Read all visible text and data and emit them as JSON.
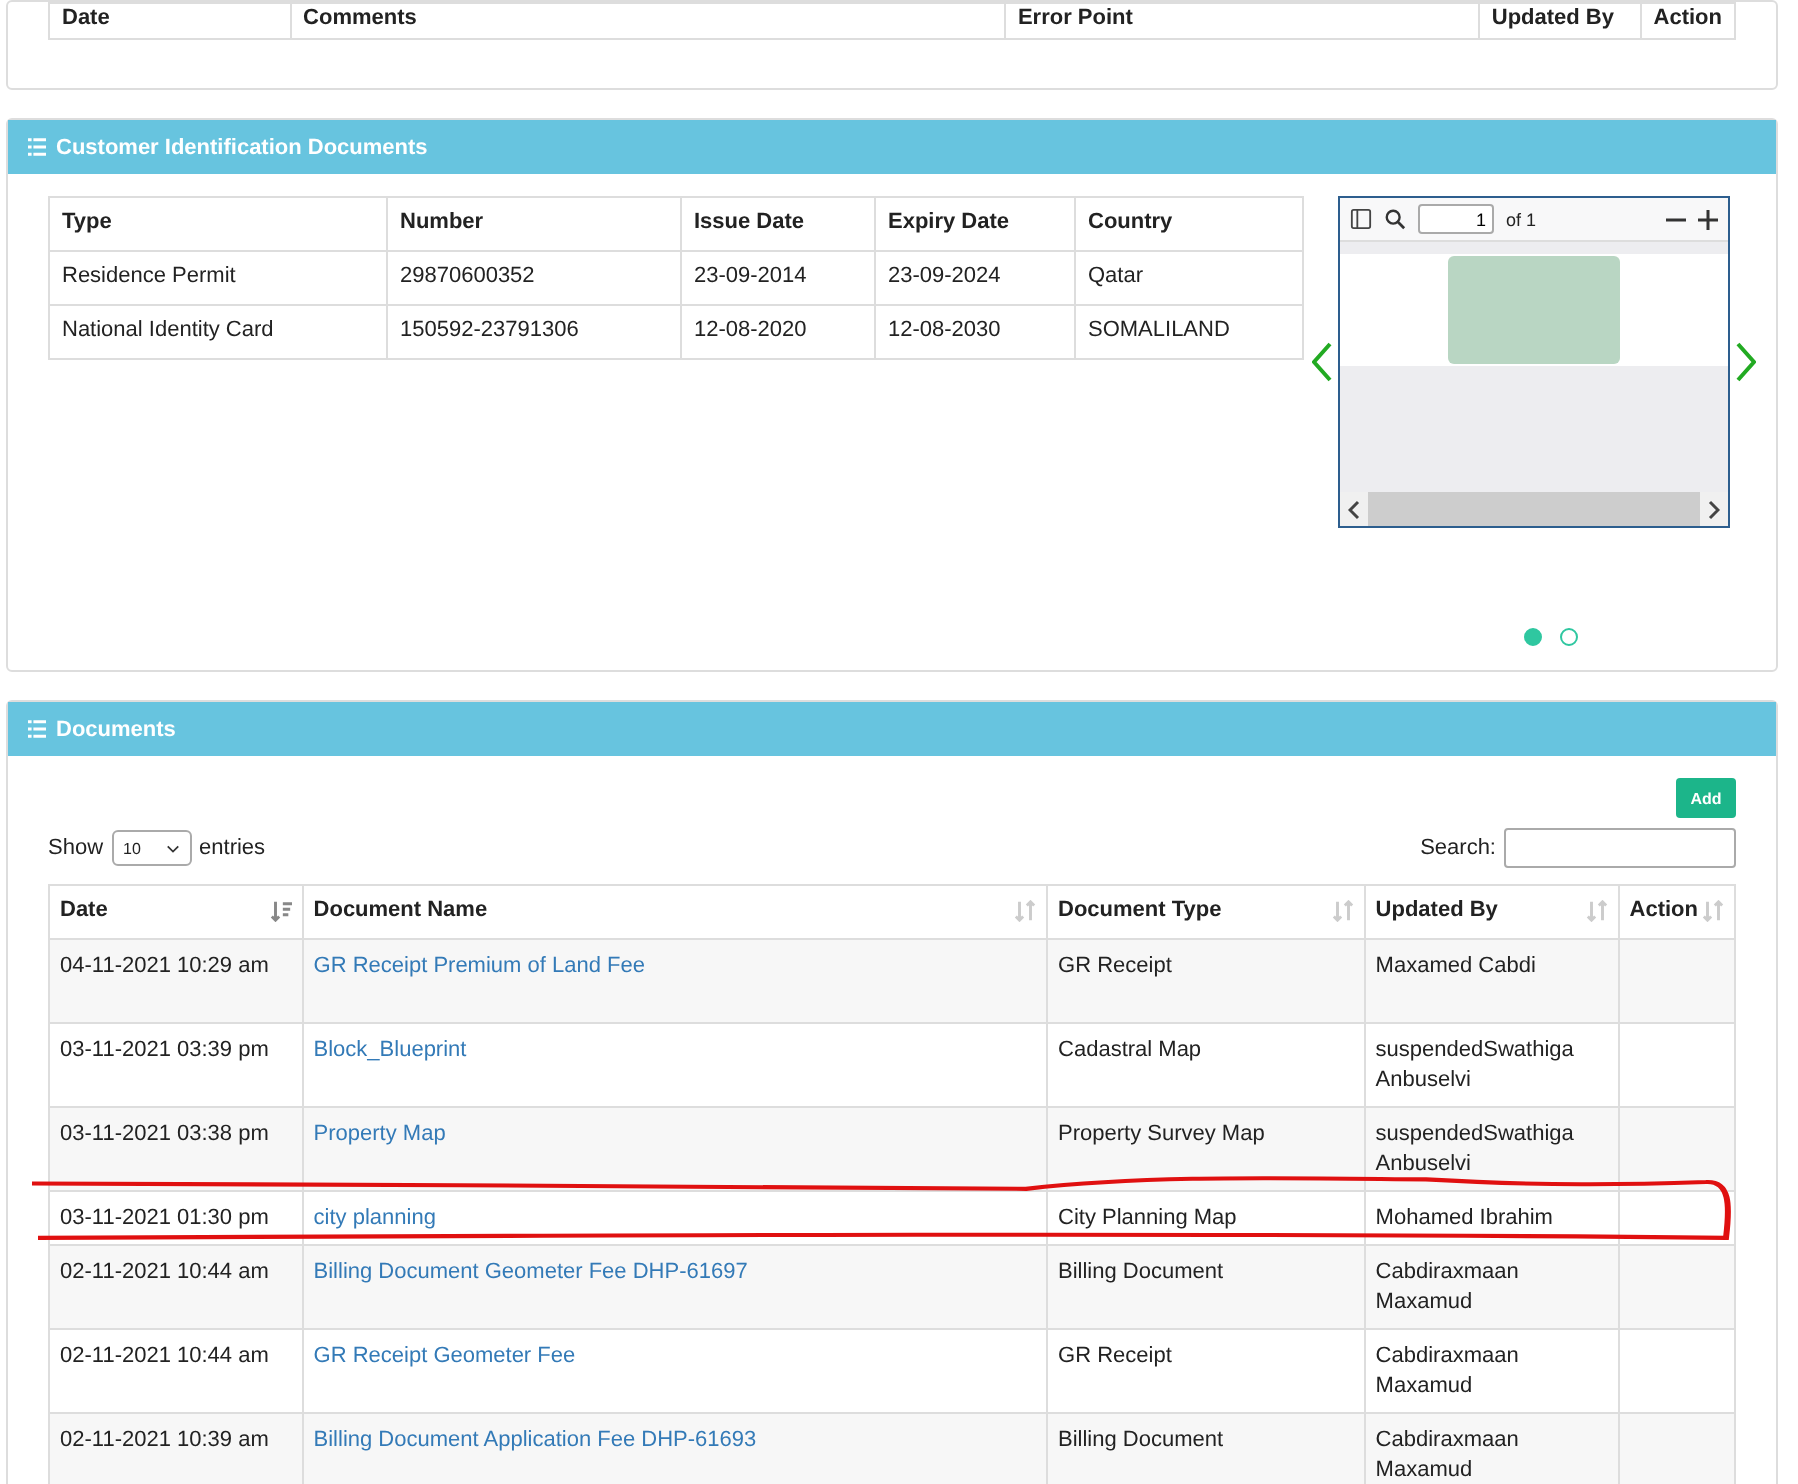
{
  "top_table": {
    "columns": [
      "Date",
      "Comments",
      "Error Point",
      "Updated By",
      "Action"
    ]
  },
  "id_documents": {
    "title": "Customer Identification Documents",
    "columns": [
      "Type",
      "Number",
      "Issue Date",
      "Expiry Date",
      "Country"
    ],
    "rows": [
      [
        "Residence Permit",
        "29870600352",
        "23-09-2014",
        "23-09-2024",
        "Qatar"
      ],
      [
        "National Identity Card",
        "150592-23791306",
        "12-08-2020",
        "12-08-2030",
        "SOMALILAND"
      ]
    ],
    "viewer": {
      "page_value": "1",
      "page_count": "of 1"
    },
    "carousel_dots": [
      {
        "selected": true
      },
      {
        "selected": false
      }
    ]
  },
  "documents": {
    "title": "Documents",
    "add_button": "Add",
    "show_label": "Show",
    "page_size": "10",
    "entries_label": "entries",
    "search_label": "Search:",
    "columns": [
      {
        "label": "Date",
        "sorted": true
      },
      {
        "label": "Document Name",
        "sorted": false
      },
      {
        "label": "Document Type",
        "sorted": false
      },
      {
        "label": "Updated By",
        "sorted": false
      },
      {
        "label": "Action",
        "sorted": false
      }
    ],
    "rows": [
      {
        "date": "04-11-2021 10:29 am",
        "name": "GR Receipt Premium of Land Fee",
        "type": "GR Receipt",
        "updated_by": "Maxamed Cabdi",
        "highlighted": false
      },
      {
        "date": "03-11-2021 03:39 pm",
        "name": "Block_Blueprint",
        "type": "Cadastral Map",
        "updated_by": "suspendedSwathiga Anbuselvi",
        "highlighted": false
      },
      {
        "date": "03-11-2021 03:38 pm",
        "name": "Property Map",
        "type": "Property Survey Map",
        "updated_by": "suspendedSwathiga Anbuselvi",
        "highlighted": false
      },
      {
        "date": "03-11-2021 01:30 pm",
        "name": "city planning",
        "type": "City Planning Map",
        "updated_by": "Mohamed Ibrahim",
        "highlighted": true
      },
      {
        "date": "02-11-2021 10:44 am",
        "name": "Billing Document Geometer Fee DHP-61697",
        "type": "Billing Document",
        "updated_by": "Cabdiraxmaan Maxamud",
        "highlighted": false
      },
      {
        "date": "02-11-2021 10:44 am",
        "name": "GR Receipt Geometer Fee",
        "type": "GR Receipt",
        "updated_by": "Cabdiraxmaan Maxamud",
        "highlighted": false
      },
      {
        "date": "02-11-2021 10:39 am",
        "name": "Billing Document Application Fee DHP-61693",
        "type": "Billing Document",
        "updated_by": "Cabdiraxmaan Maxamud",
        "highlighted": false
      }
    ]
  }
}
